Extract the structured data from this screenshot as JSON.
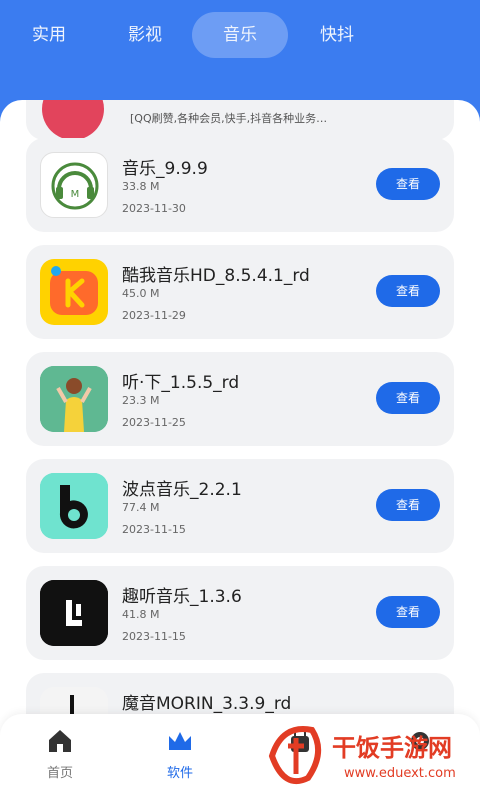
{
  "tabs": [
    {
      "label": "实用"
    },
    {
      "label": "影视"
    },
    {
      "label": "音乐"
    },
    {
      "label": "快抖"
    }
  ],
  "active_tab": "音乐",
  "partial_card": {
    "text": "[QQ刷赞,各种会员,快手,抖音各种业务…"
  },
  "apps": [
    {
      "name": "音乐_9.9.9",
      "size": "33.8 M",
      "date": "2023-11-30",
      "button": "查看",
      "icon": "headphones-icon"
    },
    {
      "name": "酷我音乐HD_8.5.4.1_rd",
      "size": "45.0 M",
      "date": "2023-11-29",
      "button": "查看",
      "icon": "kuwo-logo-icon"
    },
    {
      "name": "听·下_1.5.5_rd",
      "size": "23.3 M",
      "date": "2023-11-25",
      "button": "查看",
      "icon": "tingxia-logo-icon"
    },
    {
      "name": "波点音乐_2.2.1",
      "size": "77.4 M",
      "date": "2023-11-15",
      "button": "查看",
      "icon": "bodian-logo-icon"
    },
    {
      "name": "趣听音乐_1.3.6",
      "size": "41.8 M",
      "date": "2023-11-15",
      "button": "查看",
      "icon": "quting-logo-icon"
    },
    {
      "name": "魔音MORIN_3.3.9_rd",
      "size": "",
      "date": "",
      "button": "",
      "icon": "moyin-logo-icon"
    }
  ],
  "bottom_nav": [
    {
      "label": "首页",
      "icon": "home-icon"
    },
    {
      "label": "软件",
      "icon": "crown-icon"
    },
    {
      "label": "",
      "icon": "bag-icon"
    },
    {
      "label": "",
      "icon": "gear-icon"
    }
  ],
  "watermark": {
    "title": "干饭手游网",
    "url": "www.eduext.com"
  },
  "colors": {
    "primary": "#3b7cf0",
    "button": "#1f6ae8",
    "card": "#f1f2f4",
    "watermark": "#e23c24"
  }
}
